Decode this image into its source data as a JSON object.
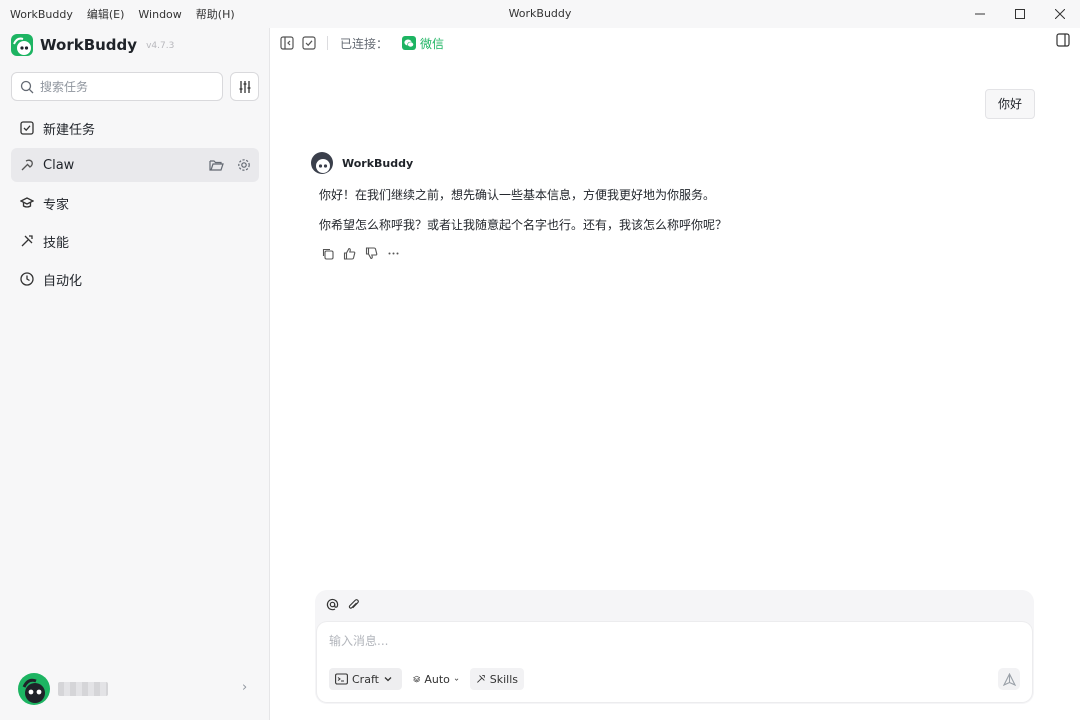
{
  "titlebar": {
    "menu": [
      "WorkBuddy",
      "编辑(E)",
      "Window",
      "帮助(H)"
    ],
    "title": "WorkBuddy"
  },
  "sidebar": {
    "brand": {
      "name": "WorkBuddy",
      "version": "v4.7.3"
    },
    "search": {
      "placeholder": "搜索任务"
    },
    "items": [
      {
        "label": "新建任务",
        "icon": "new-task-icon"
      },
      {
        "label": "Claw",
        "icon": "claw-icon",
        "active": true
      },
      {
        "label": "专家",
        "icon": "expert-icon"
      },
      {
        "label": "技能",
        "icon": "skills-icon"
      },
      {
        "label": "自动化",
        "icon": "clock-icon"
      }
    ]
  },
  "header": {
    "connected_label": "已连接：",
    "wechat_label": "微信"
  },
  "chat": {
    "user_message": "你好",
    "bot_name": "WorkBuddy",
    "bot_lines": [
      "你好！在我们继续之前，想先确认一些基本信息，方便我更好地为你服务。",
      "你希望怎么称呼我？或者让我随意起个名字也行。还有，我该怎么称呼你呢？"
    ]
  },
  "composer": {
    "placeholder": "输入消息...",
    "mode_label": "Craft",
    "model_label": "Auto",
    "skills_label": "Skills"
  },
  "colors": {
    "accent": "#1db462",
    "sidebar_bg": "#f7f7f8"
  }
}
